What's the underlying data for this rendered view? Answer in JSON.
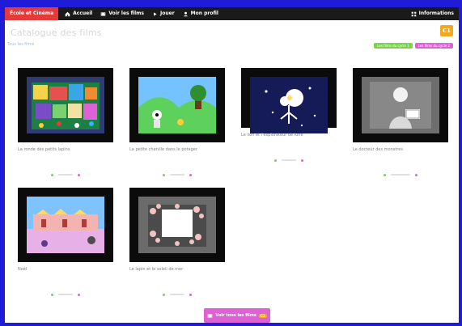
{
  "topbar": {
    "brand": "École et Cinéma",
    "nav": [
      {
        "label": "Accueil",
        "icon": "home-icon"
      },
      {
        "label": "Voir les films",
        "icon": "film-icon"
      },
      {
        "label": "Jouer",
        "icon": "play-icon"
      },
      {
        "label": "Mon profil",
        "icon": "user-icon"
      }
    ],
    "right_label": "Informations",
    "right_icon": "grid-icon"
  },
  "header": {
    "title": "Catalogue des films",
    "corner_button_label": "C1",
    "pills": [
      {
        "label": "Les films du cycle 1",
        "color": "#79d34b"
      },
      {
        "label": "Les films du cycle 2",
        "color": "#de62d6"
      }
    ],
    "small_link": "Tous les films"
  },
  "films": [
    {
      "caption": "La ronde des petits lapins",
      "scene": "collage"
    },
    {
      "caption": "La petite chenille dans le potager",
      "scene": "garden"
    },
    {
      "caption": "Le lion et l'explorateur de lune",
      "scene": "space"
    },
    {
      "caption": "Le docteur des monstres",
      "scene": "bw"
    },
    {
      "caption": "Noël",
      "scene": "village"
    },
    {
      "caption": "Le lapin et le soleil de mer",
      "scene": "flowers"
    }
  ],
  "bottom_button": {
    "label": "Voir tous les films",
    "badge": "C1"
  }
}
